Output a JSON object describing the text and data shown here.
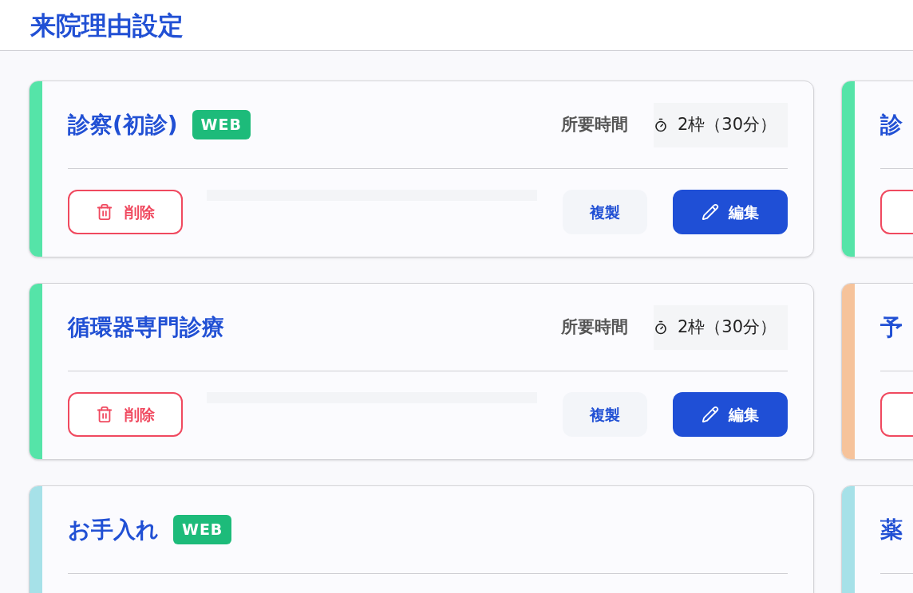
{
  "header": {
    "title": "来院理由設定"
  },
  "cards": [
    {
      "title": "診察(初診)",
      "web": true,
      "badge": "WEB",
      "color": "#55e4a8",
      "duration_label": "所要時間",
      "duration": "2枠（30分）",
      "kind": "full",
      "delete": "削除",
      "copy": "複製",
      "edit": "編集"
    },
    {
      "title": "診",
      "web": false,
      "color": "#55e4a8",
      "kind": "cut"
    },
    {
      "title": "循環器専門診療",
      "web": false,
      "color": "#55e4a8",
      "duration_label": "所要時間",
      "duration": "2枠（30分）",
      "kind": "full",
      "delete": "削除",
      "copy": "複製",
      "edit": "編集"
    },
    {
      "title": "予",
      "web": false,
      "color": "#f6c39b",
      "kind": "cut"
    },
    {
      "title": "お手入れ",
      "web": true,
      "badge": "WEB",
      "color": "#a6e1e8",
      "kind": "cut"
    },
    {
      "title": "薬",
      "web": false,
      "color": "#a6e1e8",
      "kind": "cut"
    }
  ]
}
